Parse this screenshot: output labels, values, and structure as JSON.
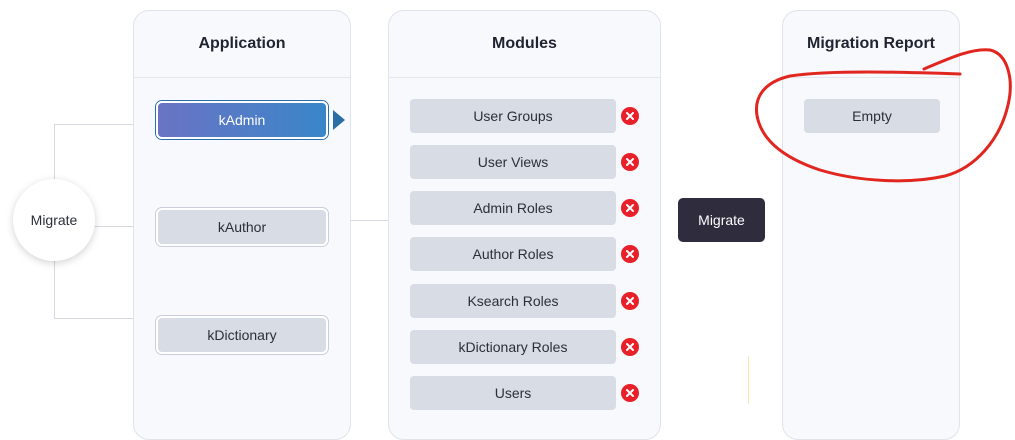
{
  "migrate_circle": {
    "label": "Migrate"
  },
  "application": {
    "title": "Application",
    "items": [
      {
        "label": "kAdmin",
        "selected": true
      },
      {
        "label": "kAuthor",
        "selected": false
      },
      {
        "label": "kDictionary",
        "selected": false
      }
    ]
  },
  "modules": {
    "title": "Modules",
    "items": [
      {
        "label": "User Groups"
      },
      {
        "label": "User Views"
      },
      {
        "label": "Admin Roles"
      },
      {
        "label": "Author Roles"
      },
      {
        "label": "Ksearch Roles"
      },
      {
        "label": "kDictionary Roles"
      },
      {
        "label": "Users"
      }
    ],
    "remove_icon": "close-circle-icon"
  },
  "migrate_button": {
    "label": "Migrate"
  },
  "report": {
    "title": "Migration Report",
    "status": "Empty"
  },
  "colors": {
    "selected_gradient_start": "#6a73c4",
    "selected_gradient_end": "#3a86c9",
    "remove_red": "#e8202a",
    "migrate_button_bg": "#2e2c3d",
    "annotation_red": "#e0261f"
  }
}
